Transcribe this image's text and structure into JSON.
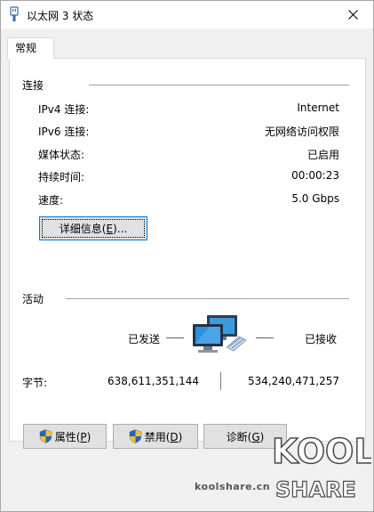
{
  "window": {
    "title": "以太网 3 状态",
    "close_icon": "close-icon"
  },
  "tabs": [
    {
      "label": "常规",
      "active": true
    }
  ],
  "connection": {
    "group_title": "连接",
    "rows": [
      {
        "label": "IPv4 连接:",
        "value": "Internet"
      },
      {
        "label": "IPv6 连接:",
        "value": "无网络访问权限"
      },
      {
        "label": "媒体状态:",
        "value": "已启用"
      },
      {
        "label": "持续时间:",
        "value": "00:00:23"
      },
      {
        "label": "速度:",
        "value": "5.0 Gbps"
      }
    ],
    "details_button": {
      "text": "详细信息(",
      "key": "E",
      "suffix": ")..."
    }
  },
  "activity": {
    "group_title": "活动",
    "sent_label": "已发送",
    "received_label": "已接收",
    "bytes_label": "字节:",
    "bytes_sent": "638,611,351,144",
    "bytes_received": "534,240,471,257",
    "icon": "network-computers-icon"
  },
  "buttons": {
    "properties": {
      "text": "属性(",
      "key": "P",
      "suffix": ")",
      "icon": "uac-shield-icon"
    },
    "disable": {
      "text": "禁用(",
      "key": "D",
      "suffix": ")",
      "icon": "uac-shield-icon"
    },
    "diagnose": {
      "text": "诊断(",
      "key": "G",
      "suffix": ")"
    }
  },
  "watermark": {
    "site": "koolshare.cn",
    "logo_top": "KOOL",
    "logo_bottom": "SHARE"
  },
  "colors": {
    "focus_border": "#0078d7",
    "dialog_background": "#f0f0f0",
    "button_face": "#e1e1e1"
  }
}
